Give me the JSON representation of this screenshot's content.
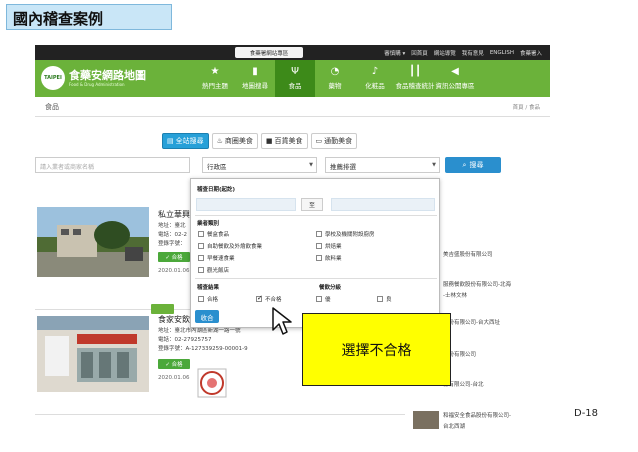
{
  "slide": {
    "title": "國內稽查案例",
    "page_number": "D-18",
    "callout": "選擇不合格"
  },
  "topbar": {
    "promo": "食藥署網站專區",
    "links": [
      "審慎購 ▾",
      "回首頁",
      "網站導覽",
      "我有意見",
      "ENGLISH",
      "食藥署入"
    ]
  },
  "logo": {
    "title": "食藥安網路地圖",
    "subtitle": "Food & Drug Administration",
    "badge": "TAIPEI"
  },
  "nav": [
    {
      "label": "熱門主題",
      "icon": "★",
      "icon_name": "star-icon",
      "active": false
    },
    {
      "label": "地圖搜尋",
      "icon": "▮",
      "icon_name": "map-icon",
      "active": false
    },
    {
      "label": "食品",
      "icon": "Ψ",
      "icon_name": "fork-knife-icon",
      "active": true
    },
    {
      "label": "藥物",
      "icon": "◔",
      "icon_name": "pill-icon",
      "active": false
    },
    {
      "label": "化粧品",
      "icon": "♪",
      "icon_name": "cosmetics-icon",
      "active": false
    },
    {
      "label": "食品稽查統計",
      "icon": "┃┃",
      "icon_name": "bar-chart-icon",
      "active": false
    },
    {
      "label": "資訊公開專區",
      "icon": "◀",
      "icon_name": "megaphone-icon",
      "active": false
    }
  ],
  "page": {
    "heading": "食品",
    "breadcrumb": "首頁 / 食品"
  },
  "tabs": [
    {
      "label": "全站搜尋",
      "icon": "▤",
      "active": true
    },
    {
      "label": "商圈美食",
      "icon": "♨",
      "active": false
    },
    {
      "label": "百貨美食",
      "icon": "■",
      "active": false
    },
    {
      "label": "通勤美食",
      "icon": "▭",
      "active": false
    }
  ],
  "search": {
    "keyword_placeholder": "請入業者或商家名稱",
    "district_value": "行政區",
    "sort_value": "推薦排選",
    "button_label": "搜尋"
  },
  "dropdown": {
    "date_label": "稽查日期(起訖)",
    "to_label": "至",
    "type_label": "業者類別",
    "types": [
      {
        "label": "餐盒食品",
        "checked": false
      },
      {
        "label": "學校及機關附設廚房",
        "checked": false
      },
      {
        "label": "自助餐飲及外燴飲食業",
        "checked": false
      },
      {
        "label": "烘焙業",
        "checked": false
      },
      {
        "label": "早餐速食業",
        "checked": false
      },
      {
        "label": "飲料業",
        "checked": false
      },
      {
        "label": "觀光飯店",
        "checked": false
      }
    ],
    "result_label": "稽查結果",
    "results": [
      {
        "label": "合格",
        "checked": false
      },
      {
        "label": "不合格",
        "checked": true
      }
    ],
    "grade_label": "餐飲分級",
    "grades": [
      {
        "label": "優",
        "checked": false
      },
      {
        "label": "良",
        "checked": false
      }
    ],
    "submit_label": "收合"
  },
  "cards": [
    {
      "name": "私立華興",
      "address": "地址：臺北",
      "phone": "電話：02-2",
      "reg": "登錄字號：",
      "badge": "✓ 合格",
      "date": "2020.01.06"
    },
    {
      "name": "食家安飲",
      "address": "地址：臺北市內湖區新湖一路一號",
      "phone": "電話：02-27925757",
      "reg": "登錄字號：A-127339259-00001-9",
      "badge": "✓ 合格",
      "date": "2020.01.06"
    }
  ],
  "right_list": [
    "美吉盛股份有限公司",
    "服務餐飲股份有限公司-北海",
    "-士林文林",
    "股份有限公司-台大西址",
    "股份有限公司",
    "份有限公司-台北",
    "和福安全食品股份有限公司-",
    "台北西湖"
  ]
}
